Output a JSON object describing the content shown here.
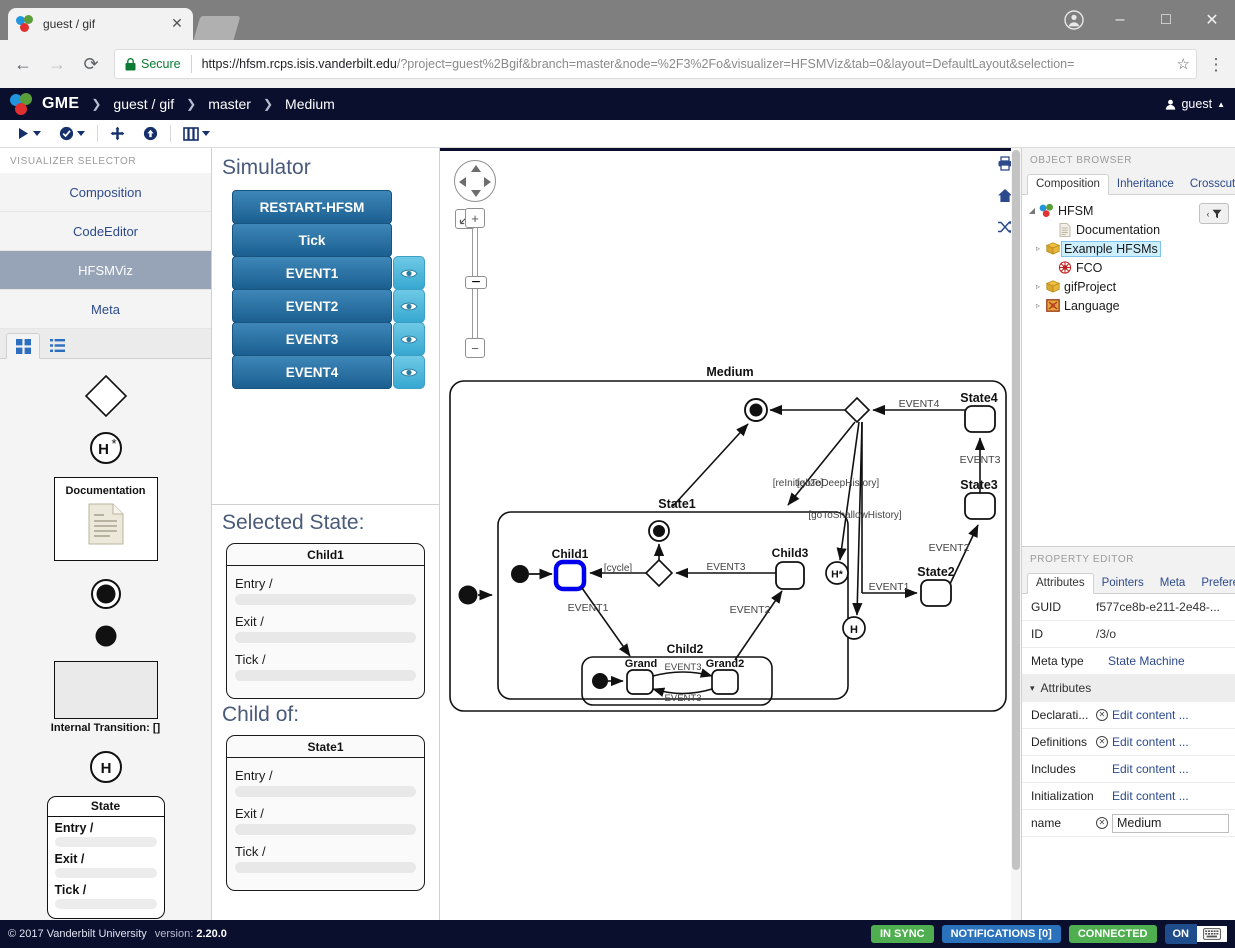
{
  "browser": {
    "tab_title": "guest / gif",
    "secure_label": "Secure",
    "url_host": "https://hfsm.rcps.isis.vanderbilt.edu",
    "url_rest": "/?project=guest%2Bgif&branch=master&node=%2F3%2Fo&visualizer=HFSMViz&tab=0&layout=DefaultLayout&selection=",
    "back_icon": "←",
    "forward_icon": "→",
    "reload_icon": "⟳",
    "star_icon": "☆",
    "menu_icon": "⋮",
    "minimize_icon": "–",
    "maximize_icon": "□",
    "close_icon": "✕",
    "tab_close_icon": "✕"
  },
  "gme_header": {
    "brand": "GME",
    "breadcrumbs": [
      "guest / gif",
      "master",
      "Medium"
    ],
    "separator": "❯",
    "user": "guest",
    "user_caret": "▲"
  },
  "toolbar": {
    "items": [
      {
        "name": "run-button",
        "glyph": "▶",
        "has_caret": true
      },
      {
        "name": "check-button",
        "glyph": "✔",
        "has_caret": true
      },
      {
        "name": "move-button",
        "glyph": "✥",
        "has_caret": false
      },
      {
        "name": "upload-button",
        "glyph": "⬆",
        "has_caret": false
      },
      {
        "name": "layout-button",
        "glyph": "▐▌",
        "has_caret": true
      }
    ]
  },
  "visualizer_selector": {
    "title": "VISUALIZER SELECTOR",
    "items": [
      {
        "label": "Composition",
        "active": false
      },
      {
        "label": "CodeEditor",
        "active": false
      },
      {
        "label": "HFSMViz",
        "active": true
      },
      {
        "label": "Meta",
        "active": false
      }
    ],
    "part_tabs": [
      {
        "name": "grid-view-tab",
        "active": true
      },
      {
        "name": "list-view-tab",
        "active": false
      }
    ],
    "parts": [
      {
        "name": "choice-diamond-part",
        "label": ""
      },
      {
        "name": "deep-history-part",
        "label": "H*"
      },
      {
        "name": "documentation-part",
        "label": "Documentation"
      },
      {
        "name": "end-state-part",
        "label": ""
      },
      {
        "name": "initial-state-part",
        "label": ""
      },
      {
        "name": "internal-transition-part",
        "label": "Internal Transition: []"
      },
      {
        "name": "shallow-history-part",
        "label": "H"
      },
      {
        "name": "state-part",
        "label": "State"
      }
    ],
    "state_part": {
      "title": "State",
      "rows": [
        "Entry /",
        "Exit /",
        "Tick /"
      ]
    }
  },
  "simulator": {
    "title": "Simulator",
    "buttons": [
      {
        "label": "RESTART-HFSM",
        "eye": false
      },
      {
        "label": "Tick",
        "eye": false
      },
      {
        "label": "EVENT1",
        "eye": true
      },
      {
        "label": "EVENT2",
        "eye": true
      },
      {
        "label": "EVENT3",
        "eye": true
      },
      {
        "label": "EVENT4",
        "eye": true
      }
    ],
    "selected_state_title": "Selected State:",
    "selected_state": {
      "name": "Child1",
      "rows": [
        "Entry /",
        "Exit /",
        "Tick /"
      ]
    },
    "child_of_title": "Child of:",
    "child_of": {
      "name": "State1",
      "rows": [
        "Entry /",
        "Exit /",
        "Tick /"
      ]
    }
  },
  "canvas": {
    "icons": [
      {
        "name": "print-icon",
        "glyph": "⎙"
      },
      {
        "name": "home-icon",
        "glyph": "⌂"
      },
      {
        "name": "shuffle-icon",
        "glyph": "⇄"
      }
    ],
    "pan_control": {
      "name": "pan-control"
    },
    "fit_icon": "⤢",
    "zoom_in_icon": "+",
    "zoom_out_icon": "−",
    "zoom_handle_icon": "−"
  },
  "diagram": {
    "root_label": "Medium",
    "state1_label": "State1",
    "child1_label": "Child1",
    "child2_label": "Child2",
    "child3_label": "Child3",
    "grand_label": "Grand",
    "grand2_label": "Grand2",
    "state2_label": "State2",
    "state3_label": "State3",
    "state4_label": "State4",
    "deep_history_label": "H*",
    "shallow_history_label": "H",
    "transitions": [
      "EVENT4",
      "EVENT3",
      "EVENT2",
      "EVENT1",
      "EVENT3",
      "EVENT2",
      "EVENT1",
      "EVENT3",
      "EVENT3",
      "[cycle]",
      "[reInitialize]",
      "[goToDeepHistory]",
      "[goToShallowHistory]"
    ],
    "labels": {
      "reinitialize": "[reInitialize]",
      "deep_history": "[goToDeepHistory]",
      "shallow_history": "[goToShallowHistory]",
      "cycle": "[cycle]",
      "event1": "EVENT1",
      "event2": "EVENT2",
      "event3": "EVENT3",
      "event4": "EVENT4"
    },
    "selection_color": "#0000ee"
  },
  "object_browser": {
    "title": "OBJECT BROWSER",
    "tabs": [
      {
        "label": "Composition",
        "active": true
      },
      {
        "label": "Inheritance",
        "active": false
      },
      {
        "label": "Crosscut",
        "active": false
      }
    ],
    "filter_icon": "‹▼",
    "nodes": [
      {
        "label": "HFSM",
        "depth": 0,
        "expander": "◢",
        "icon": "hfsm-icon",
        "selected": false
      },
      {
        "label": "Documentation",
        "depth": 1,
        "expander": "",
        "icon": "doc-icon",
        "selected": false
      },
      {
        "label": "Example HFSMs",
        "depth": 1,
        "expander": "▹",
        "icon": "folder-icon",
        "selected": true
      },
      {
        "label": "FCO",
        "depth": 1,
        "expander": "",
        "icon": "fco-icon",
        "selected": false
      },
      {
        "label": "gifProject",
        "depth": 1,
        "expander": "▹",
        "icon": "folder-icon",
        "selected": false
      },
      {
        "label": "Language",
        "depth": 1,
        "expander": "▹",
        "icon": "language-icon",
        "selected": false
      }
    ]
  },
  "property_editor": {
    "title": "PROPERTY EDITOR",
    "tabs": [
      {
        "label": "Attributes",
        "active": true
      },
      {
        "label": "Pointers",
        "active": false
      },
      {
        "label": "Meta",
        "active": false
      },
      {
        "label": "Preferences",
        "active": false
      }
    ],
    "rows": [
      {
        "key": "GUID",
        "value": "f577ce8b-e211-2e48-...",
        "kind": "plain"
      },
      {
        "key": "ID",
        "value": "/3/o",
        "kind": "plain"
      },
      {
        "key": "Meta type",
        "value": "State Machine",
        "kind": "meta"
      },
      {
        "key": "Attributes",
        "value": "",
        "kind": "section",
        "caret": "▾"
      },
      {
        "key": "Declarati...",
        "value": "Edit content ...",
        "kind": "link-x"
      },
      {
        "key": "Definitions",
        "value": "Edit content ...",
        "kind": "link-x"
      },
      {
        "key": "Includes",
        "value": "Edit content ...",
        "kind": "link"
      },
      {
        "key": "Initialization",
        "value": "Edit content ...",
        "kind": "link"
      },
      {
        "key": "name",
        "value": "Medium",
        "kind": "input-x"
      }
    ]
  },
  "statusbar": {
    "copyright": "© 2017 Vanderbilt University",
    "version_label": "version:",
    "version": "2.20.0",
    "badges": [
      {
        "label": "IN SYNC",
        "color": "green"
      },
      {
        "label": "NOTIFICATIONS [0]",
        "color": "blue"
      },
      {
        "label": "CONNECTED",
        "color": "green"
      }
    ],
    "toggle_label": "ON",
    "keyboard_icon": "⌨"
  }
}
